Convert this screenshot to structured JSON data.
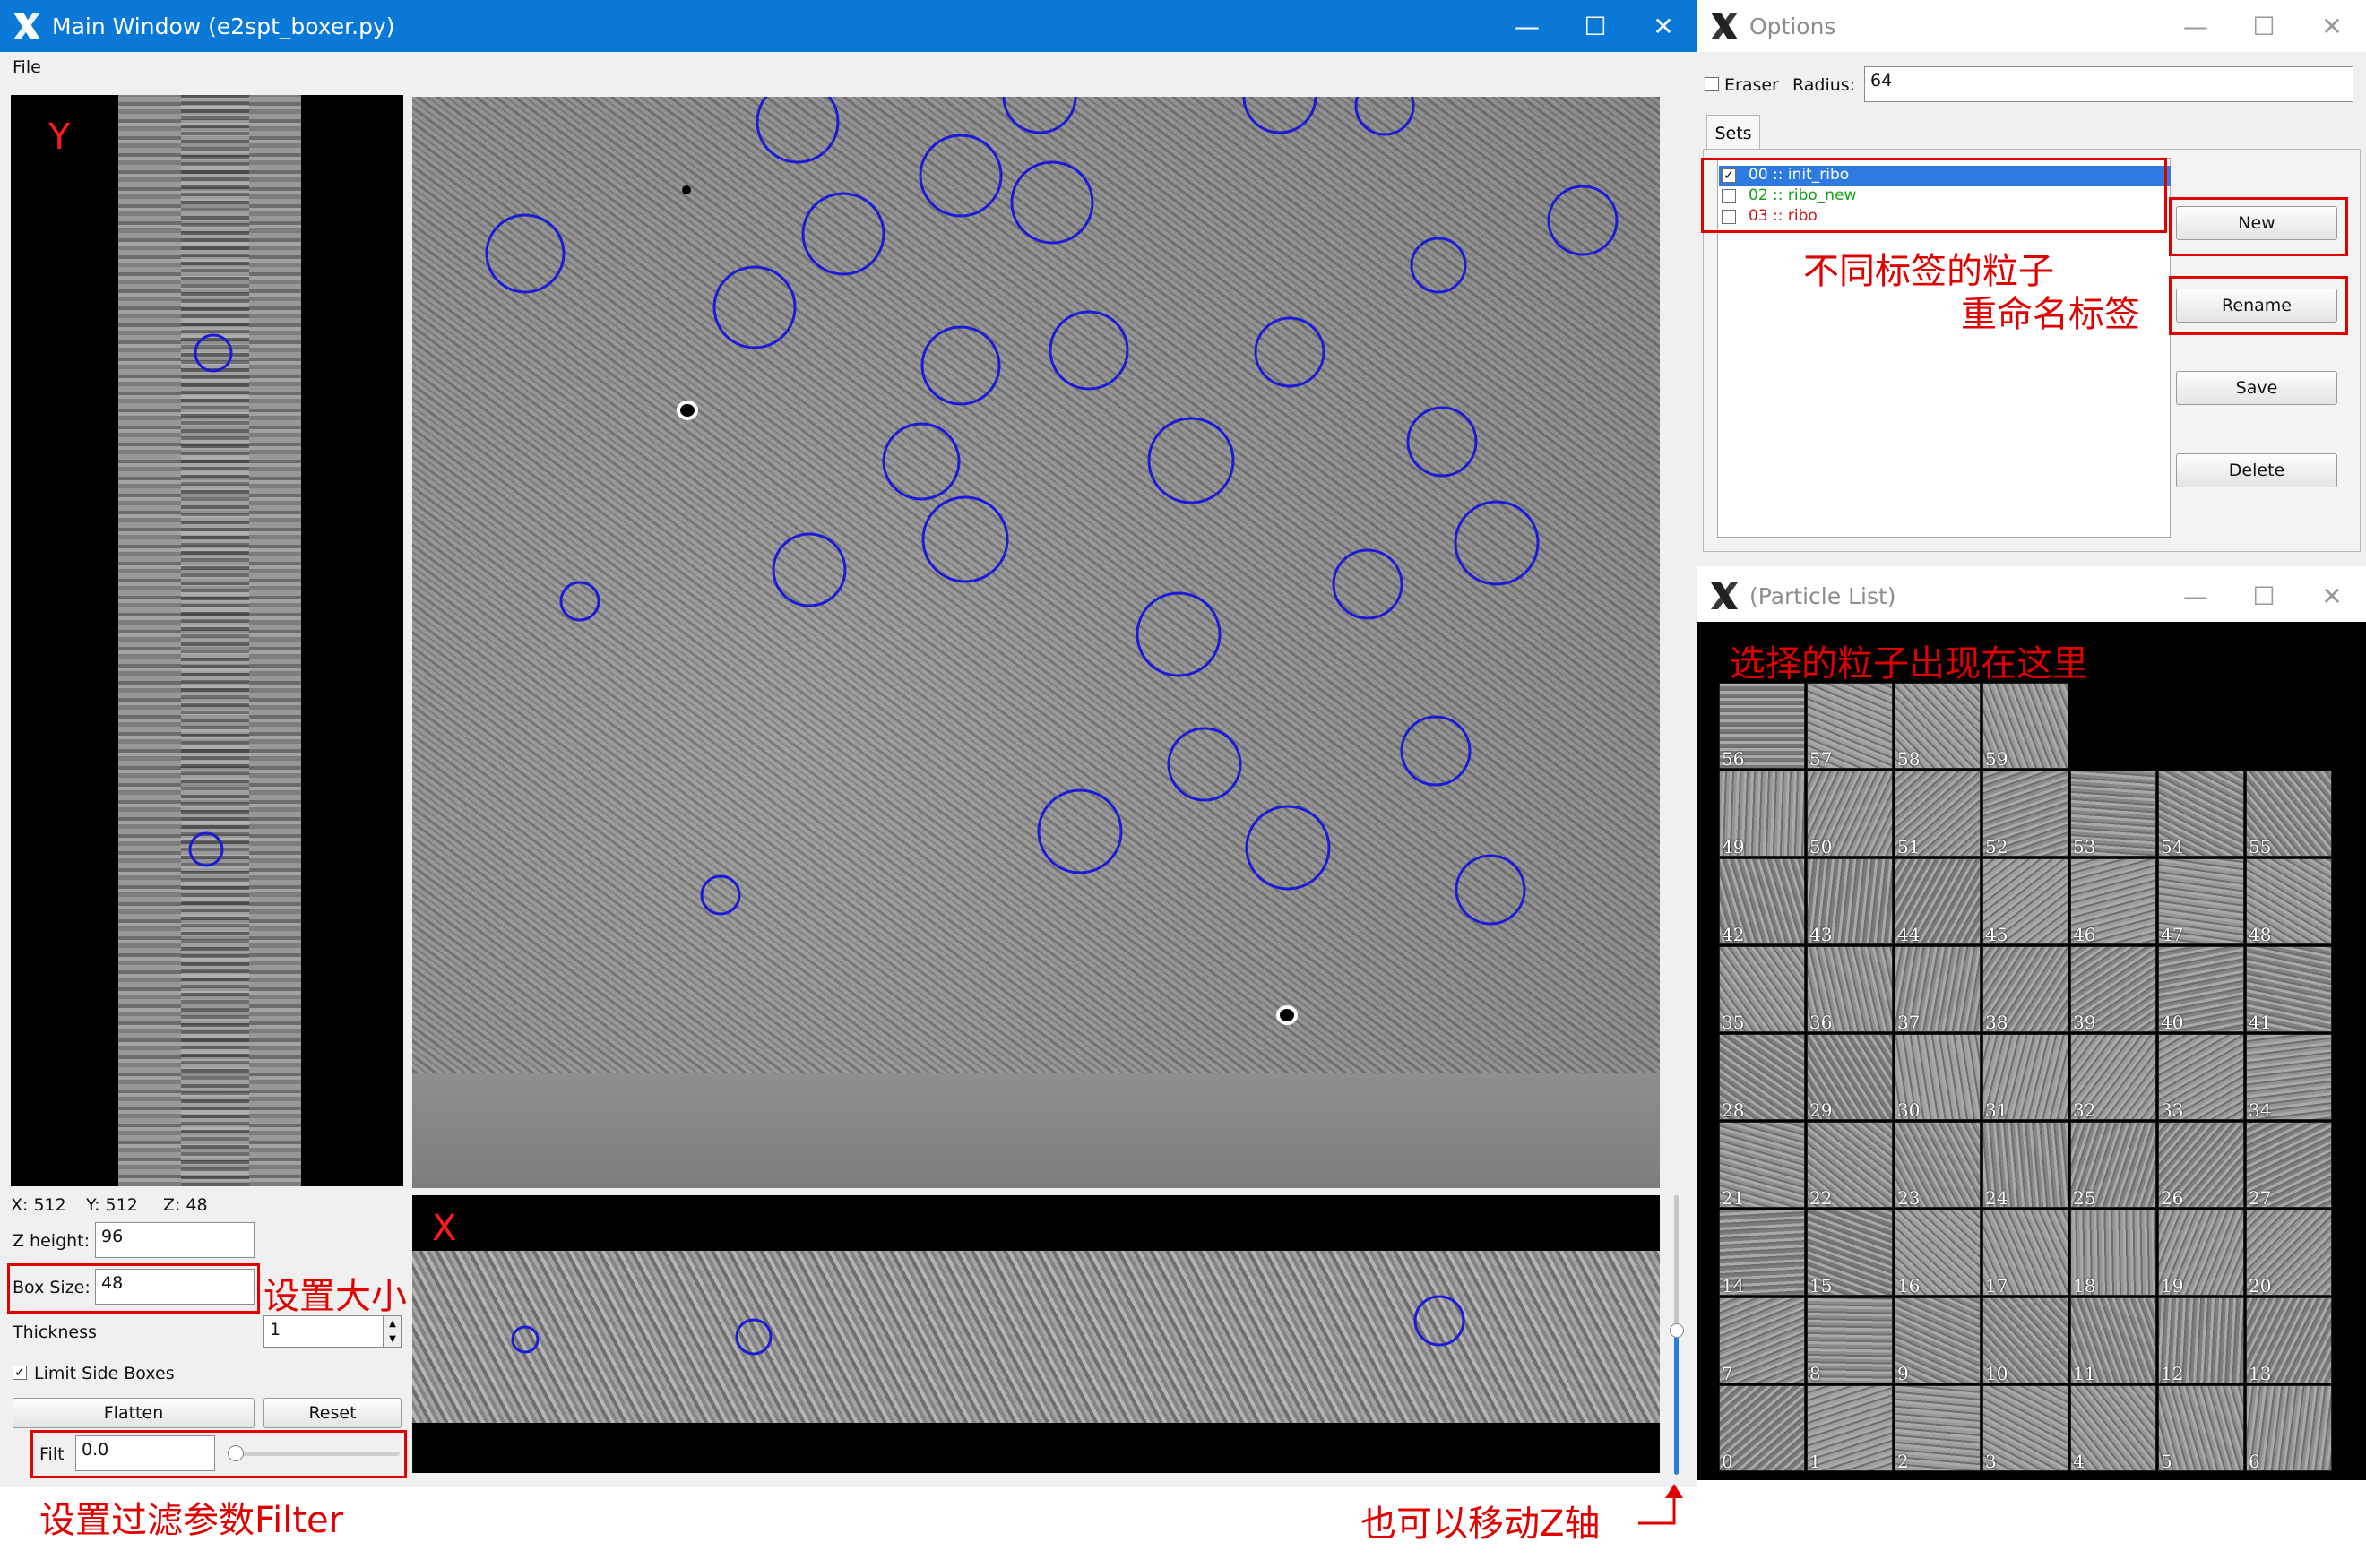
{
  "main_window": {
    "title": "Main Window (e2spt_boxer.py)",
    "menu_file": "File",
    "y_view_label": "Y",
    "x_view_label": "X",
    "coords": {
      "x": "X: 512",
      "y": "Y: 512",
      "z": "Z: 48"
    },
    "z_height_label": "Z height:",
    "z_height_value": "96",
    "box_size_label": "Box Size:",
    "box_size_value": "48",
    "thickness_label": "Thickness",
    "thickness_value": "1",
    "limit_side_boxes_label": "Limit Side Boxes",
    "limit_side_boxes_checked": true,
    "flatten_label": "Flatten",
    "reset_label": "Reset",
    "filt_label": "Filt",
    "filt_value": "0.0",
    "filt_slider_value": 0.0,
    "z_slider_value": 0.5,
    "circle_color": "#1a1ad8"
  },
  "options_window": {
    "title": "Options",
    "eraser_label": "Eraser",
    "eraser_checked": false,
    "radius_label": "Radius:",
    "radius_value": "64",
    "tab_sets": "Sets",
    "sets": [
      {
        "label": "00 :: init_ribo",
        "checked": true,
        "color": "#ffffff",
        "selected": true
      },
      {
        "label": "02 :: ribo_new",
        "checked": false,
        "color": "#14a014",
        "selected": false
      },
      {
        "label": "03 :: ribo",
        "checked": false,
        "color": "#d01818",
        "selected": false
      }
    ],
    "new_label": "New",
    "rename_label": "Rename",
    "save_label": "Save",
    "delete_label": "Delete"
  },
  "particle_window": {
    "title": "(Particle List)",
    "thumb_numbers": [
      "56",
      "57",
      "58",
      "59",
      "49",
      "50",
      "51",
      "52",
      "53",
      "54",
      "55",
      "42",
      "43",
      "44",
      "45",
      "46",
      "47",
      "48",
      "35",
      "36",
      "37",
      "38",
      "39",
      "40",
      "41",
      "28",
      "29",
      "30",
      "31",
      "32",
      "33",
      "34",
      "21",
      "22",
      "23",
      "24",
      "25",
      "26",
      "27",
      "14",
      "15",
      "16",
      "17",
      "18",
      "19",
      "20",
      "7",
      "8",
      "9",
      "10",
      "11",
      "12",
      "13",
      "0",
      "1",
      "2",
      "3",
      "4",
      "5",
      "6"
    ]
  },
  "annotations": {
    "labels_note": "不同标签的粒子",
    "rename_note": "重命名标签",
    "particles_note": "选择的粒子出现在这里",
    "box_size_note": "设置大小",
    "filter_note": "设置过滤参数Filter",
    "z_axis_note": "也可以移动Z轴"
  }
}
